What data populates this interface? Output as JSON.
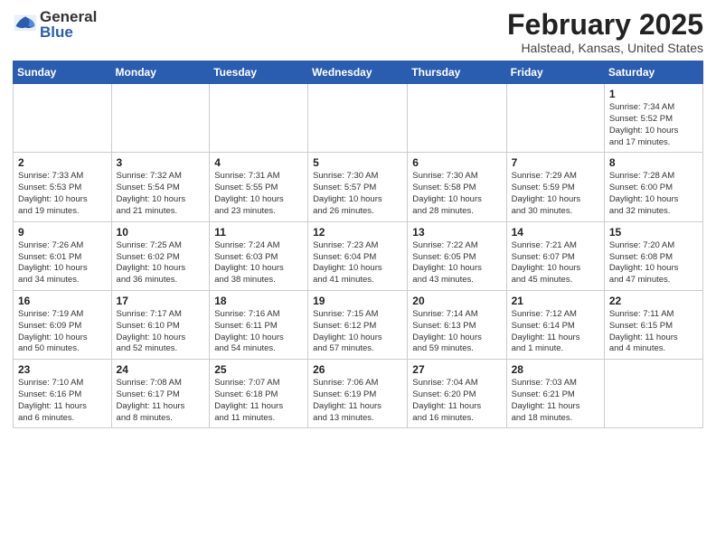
{
  "header": {
    "logo_general": "General",
    "logo_blue": "Blue",
    "month_title": "February 2025",
    "location": "Halstead, Kansas, United States"
  },
  "weekdays": [
    "Sunday",
    "Monday",
    "Tuesday",
    "Wednesday",
    "Thursday",
    "Friday",
    "Saturday"
  ],
  "weeks": [
    [
      {
        "day": "",
        "info": ""
      },
      {
        "day": "",
        "info": ""
      },
      {
        "day": "",
        "info": ""
      },
      {
        "day": "",
        "info": ""
      },
      {
        "day": "",
        "info": ""
      },
      {
        "day": "",
        "info": ""
      },
      {
        "day": "1",
        "info": "Sunrise: 7:34 AM\nSunset: 5:52 PM\nDaylight: 10 hours\nand 17 minutes."
      }
    ],
    [
      {
        "day": "2",
        "info": "Sunrise: 7:33 AM\nSunset: 5:53 PM\nDaylight: 10 hours\nand 19 minutes."
      },
      {
        "day": "3",
        "info": "Sunrise: 7:32 AM\nSunset: 5:54 PM\nDaylight: 10 hours\nand 21 minutes."
      },
      {
        "day": "4",
        "info": "Sunrise: 7:31 AM\nSunset: 5:55 PM\nDaylight: 10 hours\nand 23 minutes."
      },
      {
        "day": "5",
        "info": "Sunrise: 7:30 AM\nSunset: 5:57 PM\nDaylight: 10 hours\nand 26 minutes."
      },
      {
        "day": "6",
        "info": "Sunrise: 7:30 AM\nSunset: 5:58 PM\nDaylight: 10 hours\nand 28 minutes."
      },
      {
        "day": "7",
        "info": "Sunrise: 7:29 AM\nSunset: 5:59 PM\nDaylight: 10 hours\nand 30 minutes."
      },
      {
        "day": "8",
        "info": "Sunrise: 7:28 AM\nSunset: 6:00 PM\nDaylight: 10 hours\nand 32 minutes."
      }
    ],
    [
      {
        "day": "9",
        "info": "Sunrise: 7:26 AM\nSunset: 6:01 PM\nDaylight: 10 hours\nand 34 minutes."
      },
      {
        "day": "10",
        "info": "Sunrise: 7:25 AM\nSunset: 6:02 PM\nDaylight: 10 hours\nand 36 minutes."
      },
      {
        "day": "11",
        "info": "Sunrise: 7:24 AM\nSunset: 6:03 PM\nDaylight: 10 hours\nand 38 minutes."
      },
      {
        "day": "12",
        "info": "Sunrise: 7:23 AM\nSunset: 6:04 PM\nDaylight: 10 hours\nand 41 minutes."
      },
      {
        "day": "13",
        "info": "Sunrise: 7:22 AM\nSunset: 6:05 PM\nDaylight: 10 hours\nand 43 minutes."
      },
      {
        "day": "14",
        "info": "Sunrise: 7:21 AM\nSunset: 6:07 PM\nDaylight: 10 hours\nand 45 minutes."
      },
      {
        "day": "15",
        "info": "Sunrise: 7:20 AM\nSunset: 6:08 PM\nDaylight: 10 hours\nand 47 minutes."
      }
    ],
    [
      {
        "day": "16",
        "info": "Sunrise: 7:19 AM\nSunset: 6:09 PM\nDaylight: 10 hours\nand 50 minutes."
      },
      {
        "day": "17",
        "info": "Sunrise: 7:17 AM\nSunset: 6:10 PM\nDaylight: 10 hours\nand 52 minutes."
      },
      {
        "day": "18",
        "info": "Sunrise: 7:16 AM\nSunset: 6:11 PM\nDaylight: 10 hours\nand 54 minutes."
      },
      {
        "day": "19",
        "info": "Sunrise: 7:15 AM\nSunset: 6:12 PM\nDaylight: 10 hours\nand 57 minutes."
      },
      {
        "day": "20",
        "info": "Sunrise: 7:14 AM\nSunset: 6:13 PM\nDaylight: 10 hours\nand 59 minutes."
      },
      {
        "day": "21",
        "info": "Sunrise: 7:12 AM\nSunset: 6:14 PM\nDaylight: 11 hours\nand 1 minute."
      },
      {
        "day": "22",
        "info": "Sunrise: 7:11 AM\nSunset: 6:15 PM\nDaylight: 11 hours\nand 4 minutes."
      }
    ],
    [
      {
        "day": "23",
        "info": "Sunrise: 7:10 AM\nSunset: 6:16 PM\nDaylight: 11 hours\nand 6 minutes."
      },
      {
        "day": "24",
        "info": "Sunrise: 7:08 AM\nSunset: 6:17 PM\nDaylight: 11 hours\nand 8 minutes."
      },
      {
        "day": "25",
        "info": "Sunrise: 7:07 AM\nSunset: 6:18 PM\nDaylight: 11 hours\nand 11 minutes."
      },
      {
        "day": "26",
        "info": "Sunrise: 7:06 AM\nSunset: 6:19 PM\nDaylight: 11 hours\nand 13 minutes."
      },
      {
        "day": "27",
        "info": "Sunrise: 7:04 AM\nSunset: 6:20 PM\nDaylight: 11 hours\nand 16 minutes."
      },
      {
        "day": "28",
        "info": "Sunrise: 7:03 AM\nSunset: 6:21 PM\nDaylight: 11 hours\nand 18 minutes."
      },
      {
        "day": "",
        "info": ""
      }
    ]
  ]
}
